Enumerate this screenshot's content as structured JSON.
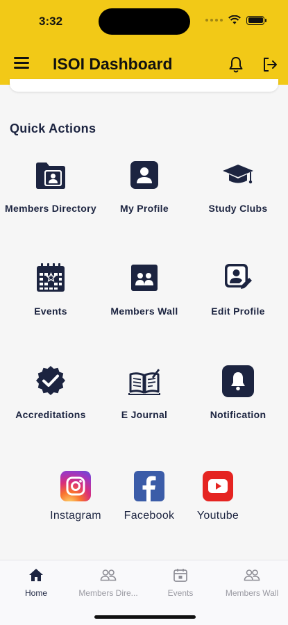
{
  "status_bar": {
    "time": "3:32"
  },
  "header": {
    "title": "ISOI Dashboard"
  },
  "quick_actions": {
    "title": "Quick Actions",
    "items": [
      {
        "label": "Members Directory",
        "icon": "folder-user-icon"
      },
      {
        "label": "My Profile",
        "icon": "profile-icon"
      },
      {
        "label": "Study Clubs",
        "icon": "graduation-cap-icon"
      },
      {
        "label": "Events",
        "icon": "calendar-star-icon"
      },
      {
        "label": "Members Wall",
        "icon": "members-wall-icon"
      },
      {
        "label": "Edit Profile",
        "icon": "edit-profile-icon"
      },
      {
        "label": "Accreditations",
        "icon": "verified-badge-icon"
      },
      {
        "label": "E Journal",
        "icon": "open-book-icon"
      },
      {
        "label": "Notification",
        "icon": "bell-icon"
      }
    ]
  },
  "social": [
    {
      "label": "Instagram",
      "icon": "instagram-icon"
    },
    {
      "label": "Facebook",
      "icon": "facebook-icon"
    },
    {
      "label": "Youtube",
      "icon": "youtube-icon"
    }
  ],
  "tabs": [
    {
      "label": "Home",
      "icon": "home-icon",
      "active": true
    },
    {
      "label": "Members Dire...",
      "icon": "people-icon",
      "active": false
    },
    {
      "label": "Events",
      "icon": "calendar-icon",
      "active": false
    },
    {
      "label": "Members Wall",
      "icon": "people-icon",
      "active": false
    }
  ],
  "colors": {
    "header": "#f2c917",
    "primary": "#1c2440",
    "background": "#f6f6f6"
  }
}
